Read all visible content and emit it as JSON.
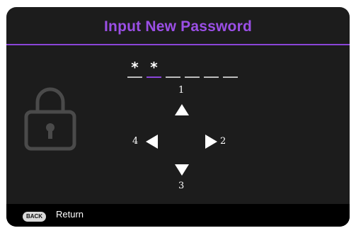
{
  "dialog": {
    "title": "Input New Password",
    "accent_color": "#8a45d8",
    "title_color": "#9b4fe6",
    "lock_icon": "lock-icon"
  },
  "password": {
    "slots": [
      "*",
      "*",
      "",
      "",
      "",
      ""
    ],
    "active_slot_index": 1
  },
  "directions": {
    "up": {
      "number": "1",
      "icon": "arrow-up-icon"
    },
    "right": {
      "number": "2",
      "icon": "arrow-right-icon"
    },
    "down": {
      "number": "3",
      "icon": "arrow-down-icon"
    },
    "left": {
      "number": "4",
      "icon": "arrow-left-icon"
    }
  },
  "footer": {
    "back_key": "BACK",
    "return_label": "Return"
  }
}
